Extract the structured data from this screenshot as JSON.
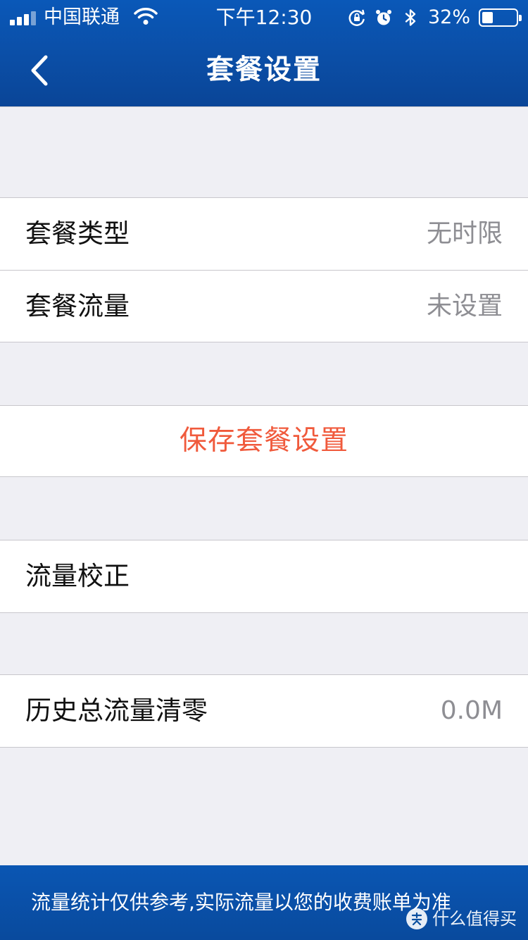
{
  "status_bar": {
    "carrier": "中国联通",
    "time": "下午12:30",
    "battery_percent": "32%",
    "battery_level": 0.32,
    "icons": [
      "signal-icon",
      "wifi-icon",
      "orientation-lock-icon",
      "alarm-icon",
      "bluetooth-icon",
      "battery-icon"
    ]
  },
  "nav": {
    "title": "套餐设置",
    "back_icon": "chevron-left-icon"
  },
  "plan_settings": {
    "rows": [
      {
        "label": "套餐类型",
        "value": "无时限"
      },
      {
        "label": "套餐流量",
        "value": "未设置"
      }
    ]
  },
  "save_action": {
    "label": "保存套餐设置",
    "color": "#f05a3c"
  },
  "calibration": {
    "label": "流量校正"
  },
  "history": {
    "label": "历史总流量清零",
    "value": "0.0M"
  },
  "footer": {
    "notice": "流量统计仅供参考,实际流量以您的收费账单为准"
  },
  "watermark": {
    "text": "什么值得买"
  },
  "colors": {
    "header_blue": "#0b4ea6",
    "background": "#efeff4",
    "accent_red": "#f05a3c",
    "value_gray": "#8e8e93"
  }
}
